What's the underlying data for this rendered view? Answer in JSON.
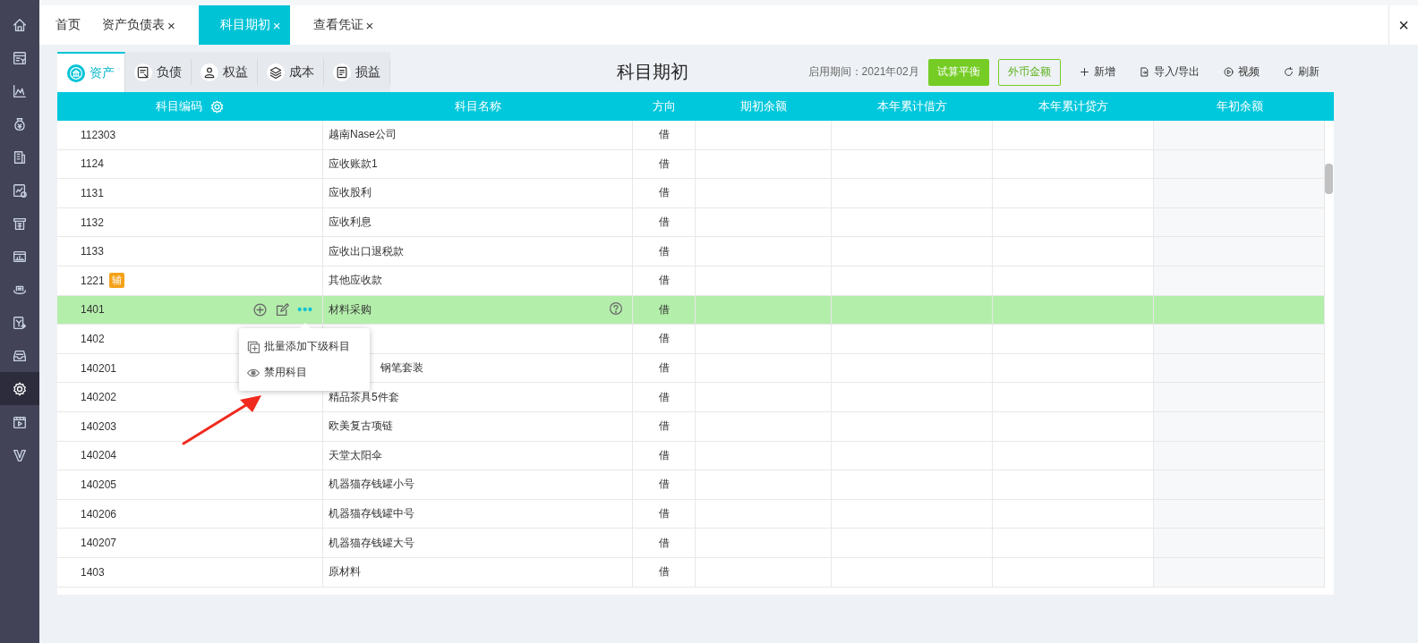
{
  "sidebar": {
    "items": [
      {
        "selected": false
      },
      {
        "selected": false
      },
      {
        "selected": false
      },
      {
        "selected": false
      },
      {
        "selected": false
      },
      {
        "selected": false
      },
      {
        "selected": false
      },
      {
        "selected": false
      },
      {
        "selected": false
      },
      {
        "selected": false
      },
      {
        "selected": false
      },
      {
        "selected": true
      },
      {
        "selected": false
      },
      {
        "selected": false
      }
    ]
  },
  "tabs": [
    {
      "label": "首页",
      "selected": false
    },
    {
      "label": "资产负债表",
      "close": "×",
      "selected": false
    },
    {
      "label": "科目期初",
      "close": "×",
      "selected": true
    },
    {
      "label": "查看凭证",
      "close": "×",
      "selected": false
    }
  ],
  "window_close": "×",
  "category_tabs": [
    {
      "label": "资产",
      "selected": true
    },
    {
      "label": "负债",
      "selected": false
    },
    {
      "label": "权益",
      "selected": false
    },
    {
      "label": "成本",
      "selected": false
    },
    {
      "label": "损益",
      "selected": false
    }
  ],
  "title": "科目期初",
  "period": "启用期间：2021年02月",
  "actions": [
    {
      "kind": "primary",
      "label": "试算平衡"
    },
    {
      "kind": "outline",
      "label": "外币金额"
    },
    {
      "kind": "link",
      "label": "新增"
    },
    {
      "kind": "link",
      "label": "导入/导出"
    },
    {
      "kind": "link",
      "label": "视频"
    },
    {
      "kind": "link",
      "label": "刷新"
    }
  ],
  "table": {
    "columns": [
      {
        "label": "科目编码"
      },
      {
        "label": "科目名称"
      },
      {
        "label": "方向"
      },
      {
        "label": "期初余额"
      },
      {
        "label": "本年累计借方"
      },
      {
        "label": "本年累计贷方"
      },
      {
        "label": "年初余额"
      }
    ],
    "rows": [
      {
        "code": "112303",
        "name": "越南Nase公司",
        "direction": "借",
        "selected": false
      },
      {
        "code": "1124",
        "name": "应收账款1",
        "direction": "借",
        "selected": false
      },
      {
        "code": "1131",
        "name": "应收股利",
        "direction": "借",
        "selected": false
      },
      {
        "code": "1132",
        "name": "应收利息",
        "direction": "借",
        "selected": false
      },
      {
        "code": "1133",
        "name": "应收出口退税款",
        "direction": "借",
        "selected": false
      },
      {
        "code": "1221",
        "badge": "辅",
        "name": "其他应收款",
        "direction": "借",
        "selected": false
      },
      {
        "code": "1401",
        "name": "材料采购",
        "direction": "借",
        "selected": true,
        "more": "•••",
        "menu": {
          "items": [
            {
              "label": "批量添加下级科目"
            },
            {
              "label": "禁用科目"
            }
          ]
        }
      },
      {
        "code": "1402",
        "direction": "借",
        "selected": false
      },
      {
        "code": "140201",
        "name": "钢笔套装",
        "direction": "借",
        "selected": false
      },
      {
        "code": "140202",
        "name": "精品茶具5件套",
        "direction": "借",
        "selected": false
      },
      {
        "code": "140203",
        "name": "欧美复古项链",
        "direction": "借",
        "selected": false
      },
      {
        "code": "140204",
        "name": "天堂太阳伞",
        "direction": "借",
        "selected": false
      },
      {
        "code": "140205",
        "name": "机器猫存钱罐小号",
        "direction": "借",
        "selected": false
      },
      {
        "code": "140206",
        "name": "机器猫存钱罐中号",
        "direction": "借",
        "selected": false
      },
      {
        "code": "140207",
        "name": "机器猫存钱罐大号",
        "direction": "借",
        "selected": false
      },
      {
        "code": "1403",
        "name": "原材料",
        "direction": "借",
        "selected": false
      }
    ]
  }
}
